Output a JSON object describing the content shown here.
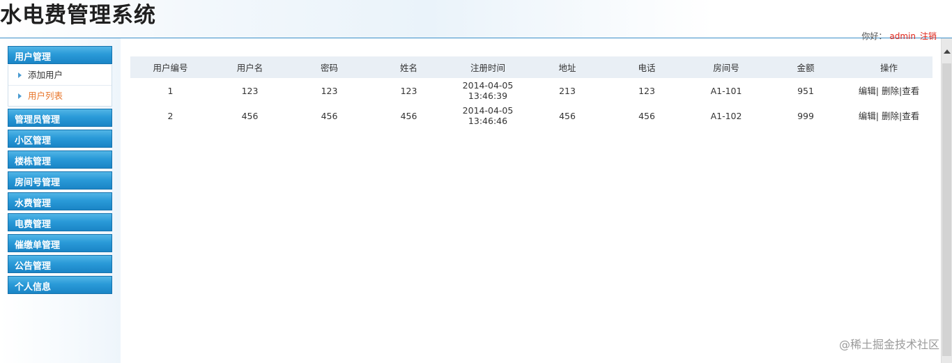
{
  "header": {
    "title": "水电费管理系统",
    "greeting_label": "你好：",
    "username": "admin",
    "logout_label": "注销"
  },
  "sidebar": {
    "groups": [
      {
        "label": "用户管理"
      },
      {
        "label": "管理员管理"
      },
      {
        "label": "小区管理"
      },
      {
        "label": "楼栋管理"
      },
      {
        "label": "房间号管理"
      },
      {
        "label": "水费管理"
      },
      {
        "label": "电费管理"
      },
      {
        "label": "催缴单管理"
      },
      {
        "label": "公告管理"
      },
      {
        "label": "个人信息"
      }
    ],
    "user_submenu": [
      {
        "label": "添加用户"
      },
      {
        "label": "用户列表",
        "active": true
      }
    ]
  },
  "table": {
    "headers": [
      "用户编号",
      "用户名",
      "密码",
      "姓名",
      "注册时间",
      "地址",
      "电话",
      "房间号",
      "金额",
      "操作"
    ],
    "rows": [
      {
        "id": "1",
        "username": "123",
        "password": "123",
        "name": "123",
        "reg_date": "2014-04-05",
        "reg_time": "13:46:39",
        "address": "213",
        "phone": "123",
        "room": "A1-101",
        "amount": "951"
      },
      {
        "id": "2",
        "username": "456",
        "password": "456",
        "name": "456",
        "reg_date": "2014-04-05",
        "reg_time": "13:46:46",
        "address": "456",
        "phone": "456",
        "room": "A1-102",
        "amount": "999"
      }
    ],
    "actions": {
      "edit": "编辑",
      "delete": "删除",
      "view": "查看",
      "separator": "|"
    }
  },
  "watermark": "@稀土掘金技术社区",
  "colors": {
    "menu_blue": "#2a9ad8",
    "active_orange": "#e8752a",
    "user_red": "#e0261b",
    "table_header_bg": "#e9eff5"
  }
}
